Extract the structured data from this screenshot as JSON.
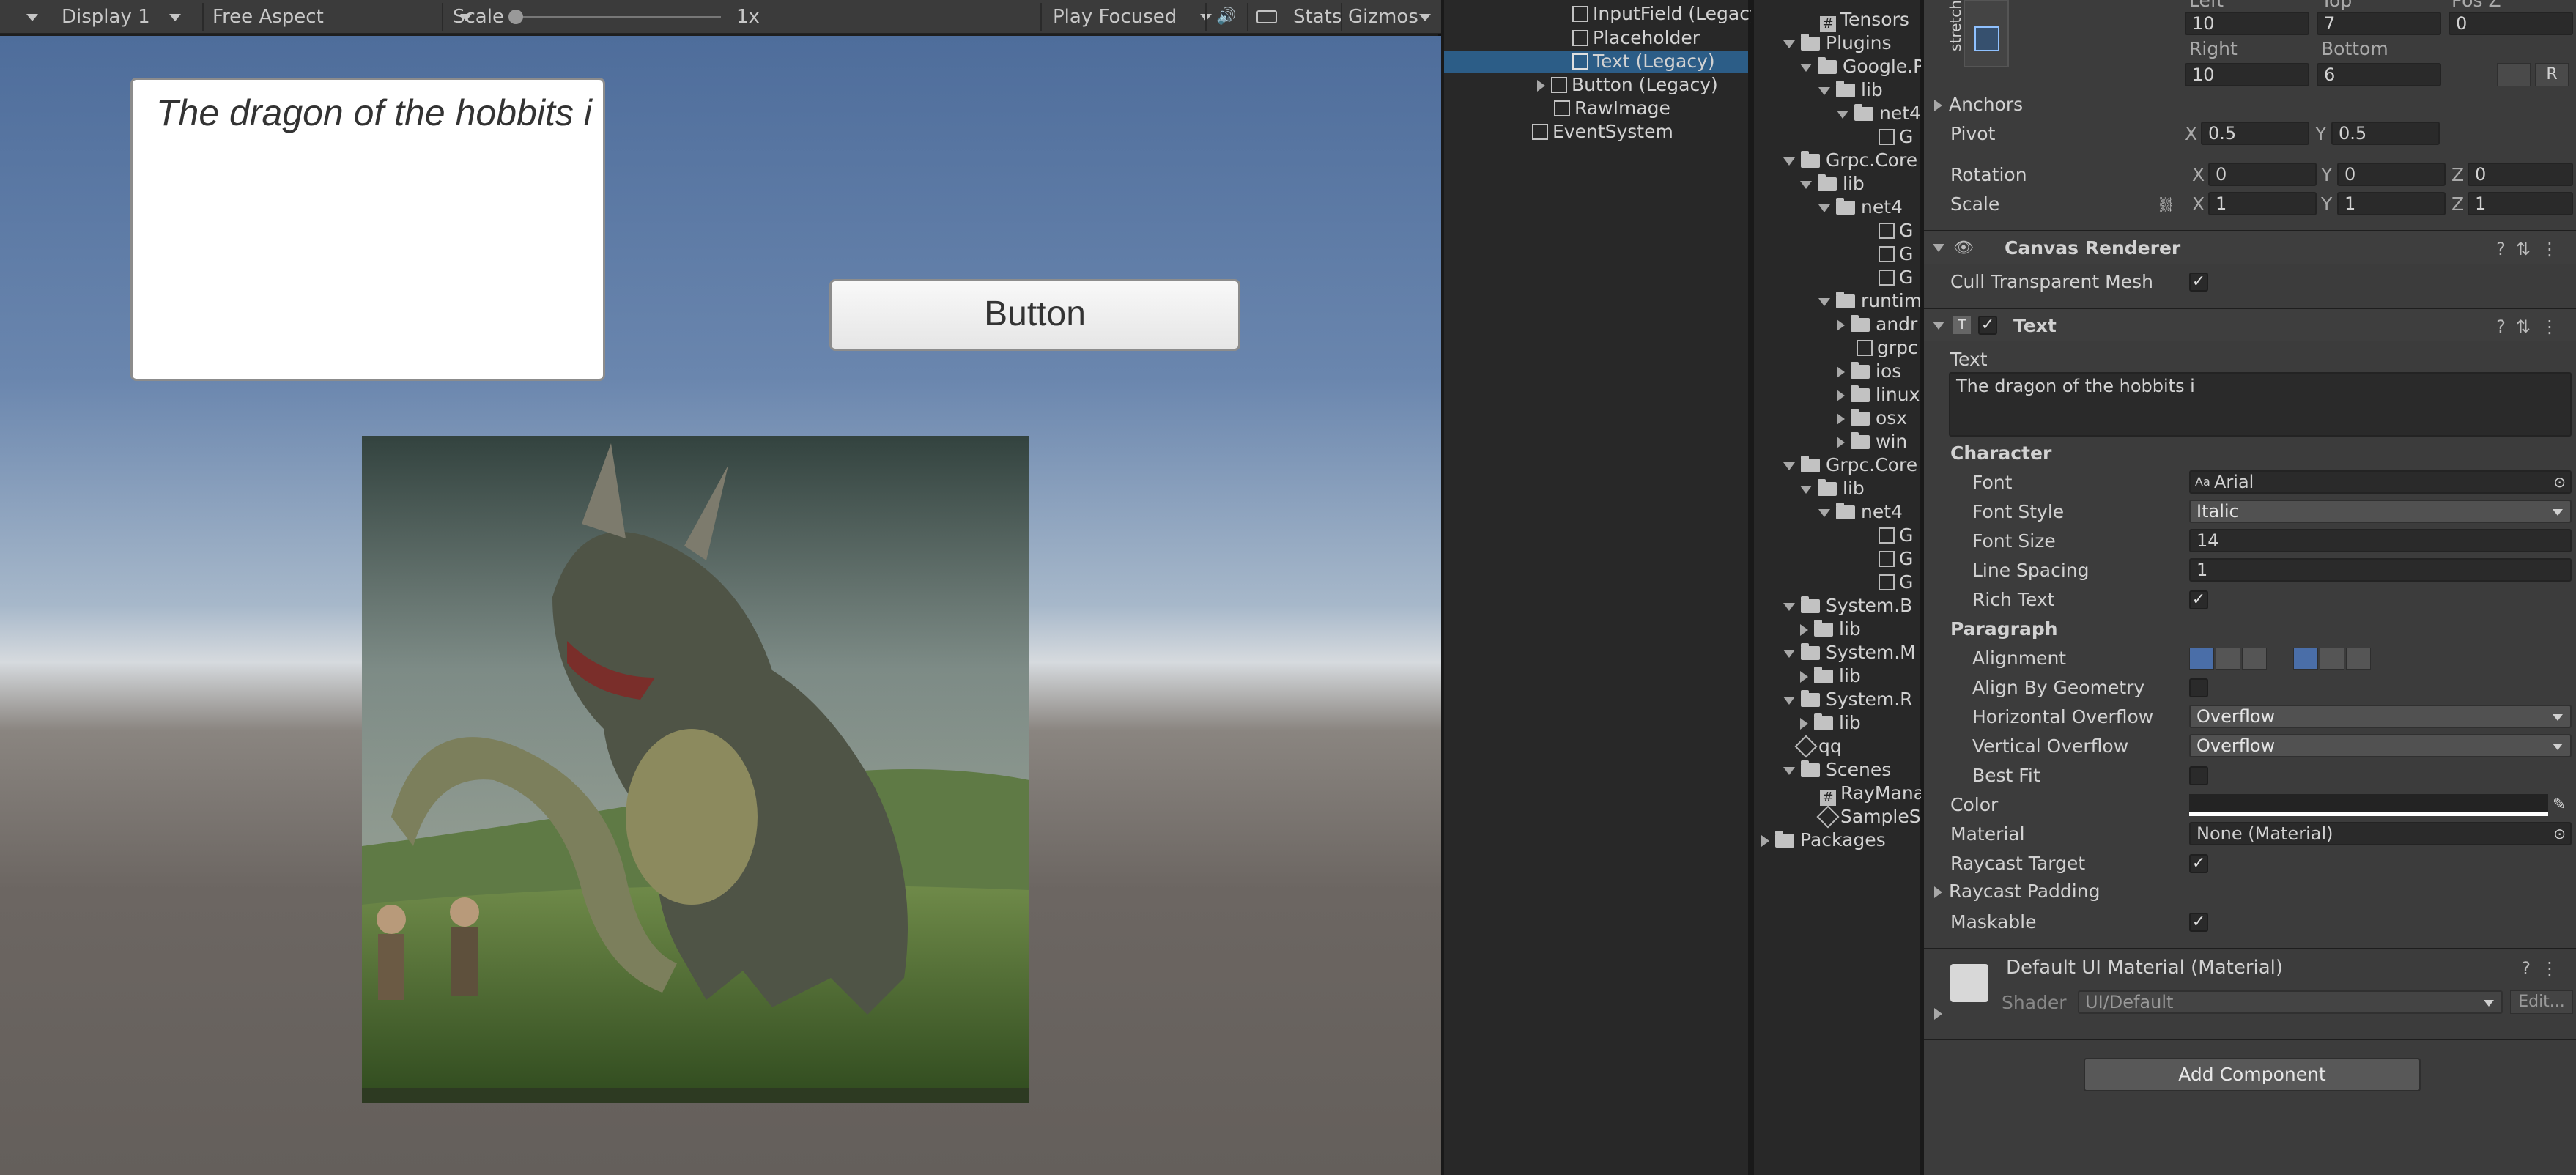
{
  "game_toolbar": {
    "display": "Display 1",
    "aspect": "Free Aspect",
    "scale_label": "Scale",
    "scale_value": "1x",
    "play_mode": "Play Focused",
    "stats": "Stats",
    "gizmos": "Gizmos"
  },
  "game_view": {
    "input_text": "The dragon of the hobbits i",
    "button_label": "Button"
  },
  "hierarchy": {
    "items": [
      "InputField (Legacy)",
      "Placeholder",
      "Text (Legacy)",
      "Button (Legacy)",
      "RawImage",
      "EventSystem"
    ]
  },
  "project": {
    "items": [
      "Tensors",
      "Plugins",
      "Google.P",
      "lib",
      "net4",
      "G",
      "Grpc.Core",
      "lib",
      "net4",
      "G",
      "G",
      "G",
      "runtime",
      "andr",
      "grpc",
      "ios",
      "linux",
      "osx",
      "win",
      "Grpc.Core",
      "lib",
      "net4",
      "G",
      "G",
      "G",
      "System.B",
      "lib",
      "System.M",
      "lib",
      "System.R",
      "lib",
      "qq",
      "Scenes",
      "RayMana",
      "SampleS",
      "Packages"
    ]
  },
  "inspector": {
    "anchor_preset": "stretch",
    "rect": {
      "left_label": "Left",
      "top_label": "Top",
      "posz_label": "Pos Z",
      "left": "10",
      "top": "7",
      "posz": "0",
      "right_label": "Right",
      "bottom_label": "Bottom",
      "right": "10",
      "bottom": "6",
      "r_btn": "R"
    },
    "anchors": "Anchors",
    "pivot": {
      "label": "Pivot",
      "x": "0.5",
      "y": "0.5"
    },
    "rotation": {
      "label": "Rotation",
      "x": "0",
      "y": "0",
      "z": "0"
    },
    "scale": {
      "label": "Scale",
      "x": "1",
      "y": "1",
      "z": "1"
    },
    "axis": {
      "x": "X",
      "y": "Y",
      "z": "Z"
    },
    "canvas_renderer": {
      "title": "Canvas Renderer",
      "cull_label": "Cull Transparent Mesh"
    },
    "text_comp": {
      "title": "Text",
      "text_label": "Text",
      "text_value": "The dragon of the hobbits i",
      "character": "Character",
      "font_label": "Font",
      "font_value": "Arial",
      "font_style_label": "Font Style",
      "font_style_value": "Italic",
      "font_size_label": "Font Size",
      "font_size_value": "14",
      "line_spacing_label": "Line Spacing",
      "line_spacing_value": "1",
      "rich_text_label": "Rich Text",
      "paragraph": "Paragraph",
      "alignment_label": "Alignment",
      "align_geo_label": "Align By Geometry",
      "h_overflow_label": "Horizontal Overflow",
      "h_overflow_value": "Overflow",
      "v_overflow_label": "Vertical Overflow",
      "v_overflow_value": "Overflow",
      "best_fit_label": "Best Fit",
      "color_label": "Color",
      "material_label": "Material",
      "material_value": "None (Material)",
      "raycast_target_label": "Raycast Target",
      "raycast_padding_label": "Raycast Padding",
      "maskable_label": "Maskable"
    },
    "material_block": {
      "title": "Default UI Material (Material)",
      "shader_label": "Shader",
      "shader_value": "UI/Default",
      "edit": "Edit..."
    },
    "add_component": "Add Component"
  },
  "colors": {
    "selection": "#2c5d87",
    "accent_blue": "#4a6ea8"
  }
}
